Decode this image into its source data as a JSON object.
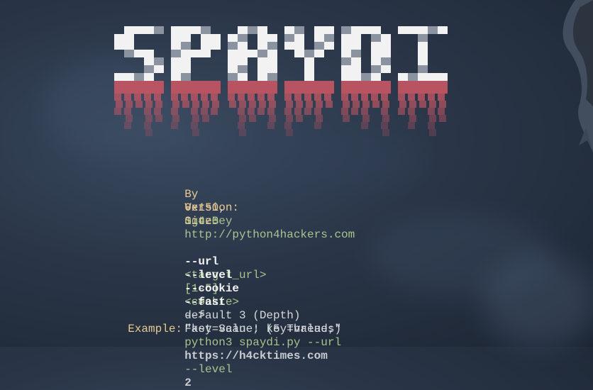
{
  "terminal": {
    "banner": {
      "by_label": "By",
      "authors_name1": "0x150",
      "authors_sep": ",",
      "authors_name2": "OguzBey",
      "version_label": "Version:",
      "version_value": "1.4.0",
      "site_label": "Site:",
      "site_value": "http://python4hackers.com"
    },
    "options": [
      {
        "flag": "--url",
        "arg": "<target_url>",
        "arrow": "",
        "desc": ""
      },
      {
        "flag": "--level",
        "arg": "[1-5]",
        "arrow": "-->",
        "desc": "default 3 (Depth)"
      },
      {
        "flag": "--cookie",
        "arg": "<cookie>",
        "arrow": "-->",
        "desc": "\"key=value; key=value;\""
      },
      {
        "flag": "--fast",
        "arg": "",
        "arrow": "-->",
        "desc": "Fast Scan ! (5 Threads)"
      }
    ],
    "example": {
      "label": "Example:",
      "cmd": "python3 spaydi.py --url",
      "url": "https://h4cktimes.com",
      "level_flag": "--level",
      "level_value": "2"
    }
  },
  "colors": {
    "logo_white": "#f2f2f2",
    "logo_gray": "#8c93a0",
    "logo_red": "#c05563",
    "text_gold": "#e7c995",
    "text_green": "#a9c48e"
  }
}
